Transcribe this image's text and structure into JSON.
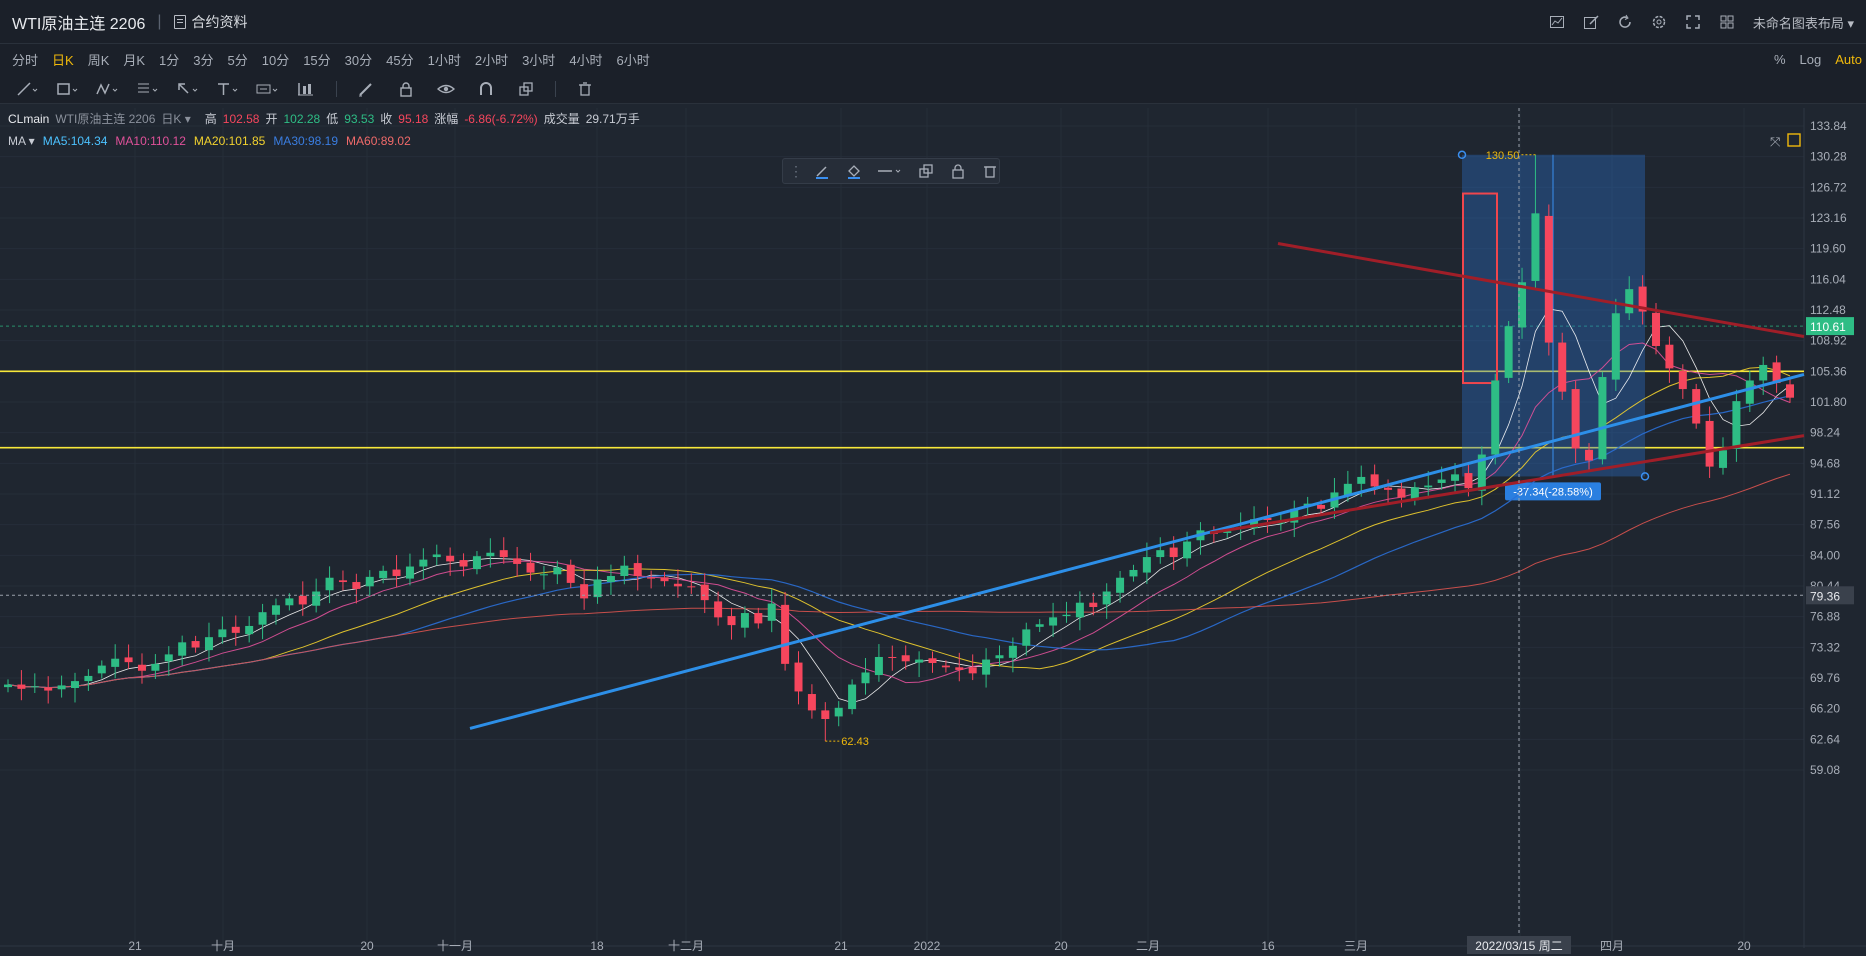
{
  "header": {
    "title": "WTI原油主连 2206",
    "contract_info": "合约资料",
    "layout_name": "未命名图表布局"
  },
  "intervals": [
    "分时",
    "日K",
    "周K",
    "月K",
    "1分",
    "3分",
    "5分",
    "10分",
    "15分",
    "30分",
    "45分",
    "1小时",
    "2小时",
    "3小时",
    "4小时",
    "6小时"
  ],
  "active_interval": "日K",
  "scale_options": {
    "percent": "%",
    "log": "Log",
    "auto": "Auto"
  },
  "legend": {
    "symbol": "CLmain",
    "name": "WTI原油主连 2206",
    "period": "日K",
    "high_label": "高",
    "high": "102.58",
    "open_label": "开",
    "open": "102.28",
    "low_label": "低",
    "low": "93.53",
    "close_label": "收",
    "close": "95.18",
    "change_label": "涨幅",
    "change": "-6.86(-6.72%)",
    "volume_label": "成交量",
    "volume": "29.71万手"
  },
  "ma_legend": {
    "label": "MA",
    "ma5": "MA5:104.34",
    "ma10": "MA10:110.12",
    "ma20": "MA20:101.85",
    "ma30": "MA30:98.19",
    "ma60": "MA60:89.02"
  },
  "colors": {
    "up": "#2ebd85",
    "down": "#f6465d",
    "ma5": "#ffffff",
    "ma10": "#e0519a",
    "ma20": "#f2d22e",
    "ma30": "#2a6fd6",
    "ma60": "#d9534f",
    "accent": "#f0b90b"
  },
  "price_axis": [
    "133.84",
    "130.28",
    "126.72",
    "123.16",
    "119.60",
    "116.04",
    "112.48",
    "108.92",
    "105.36",
    "101.80",
    "98.24",
    "94.68",
    "91.12",
    "87.56",
    "84.00",
    "80.44",
    "76.88",
    "73.32",
    "69.76",
    "66.20",
    "62.64",
    "59.08"
  ],
  "price_tags": {
    "last": "110.61",
    "crosshair": "79.36"
  },
  "time_axis": [
    "21",
    "十月",
    "20",
    "十一月",
    "18",
    "十二月",
    "21",
    "2022",
    "20",
    "二月",
    "16",
    "三月",
    "22",
    "四月",
    "20"
  ],
  "crosshair_date": "2022/03/15 周二",
  "annotations": {
    "high_label": "130.50",
    "low_label": "62.43",
    "measure_label": "-37.34(-28.58%)"
  },
  "chart_data": {
    "type": "candlestick",
    "instrument": "WTI原油主连 2206",
    "y_range": [
      57.3,
      135.6
    ],
    "y_ticks": [
      133.84,
      130.28,
      126.72,
      123.16,
      119.6,
      116.04,
      112.48,
      108.92,
      105.36,
      101.8,
      98.24,
      94.68,
      91.12,
      87.56,
      84.0,
      80.44,
      76.88,
      73.32,
      69.76,
      66.2,
      62.64,
      59.08
    ],
    "x_labels": [
      "21",
      "十月",
      "20",
      "十一月",
      "18",
      "十二月",
      "21",
      "2022",
      "20",
      "二月",
      "16",
      "三月",
      "22",
      "四月",
      "20"
    ],
    "closes": [
      69.0,
      68.5,
      68.8,
      68.3,
      68.9,
      69.4,
      70.0,
      71.2,
      72.0,
      71.6,
      70.6,
      71.4,
      72.5,
      73.9,
      73.3,
      74.5,
      75.4,
      75.0,
      75.8,
      77.4,
      78.2,
      79.0,
      78.3,
      79.8,
      81.4,
      80.9,
      80.1,
      81.5,
      82.2,
      81.6,
      82.7,
      83.5,
      84.1,
      83.3,
      82.7,
      83.9,
      84.3,
      83.8,
      83.0,
      82.0,
      81.8,
      82.6,
      80.8,
      79.0,
      81.2,
      81.6,
      82.8,
      81.6,
      81.3,
      81.0,
      80.4,
      80.3,
      78.8,
      76.8,
      75.9,
      77.3,
      76.1,
      78.4,
      71.4,
      68.2,
      66.0,
      65.0,
      66.3,
      69.0,
      70.4,
      72.2,
      72.1,
      71.7,
      71.9,
      71.5,
      71.0,
      70.7,
      70.3,
      71.9,
      72.4,
      73.5,
      75.4,
      76.0,
      76.8,
      77.1,
      78.5,
      78.0,
      79.8,
      81.4,
      82.3,
      83.8,
      84.6,
      83.8,
      85.6,
      86.9,
      86.6,
      86.8,
      87.3,
      88.2,
      88.1,
      87.8,
      89.4,
      90.0,
      89.4,
      91.3,
      92.3,
      93.1,
      92.0,
      91.6,
      90.7,
      91.9,
      92.1,
      92.8,
      93.4,
      91.8,
      95.7,
      104.3,
      110.6,
      115.7,
      123.7,
      108.7,
      103.0,
      96.4,
      95.0,
      104.7,
      112.1,
      114.9,
      112.3,
      108.3,
      105.7,
      103.3,
      99.3,
      94.3,
      96.2,
      101.9,
      104.3,
      106.1,
      104.0,
      102.3
    ],
    "ma_current": {
      "MA5": 104.34,
      "MA10": 110.12,
      "MA20": 101.85,
      "MA30": 98.19,
      "MA60": 89.02
    },
    "horizontal_lines": [
      105.36,
      96.5
    ],
    "high": 130.5,
    "low": 62.43,
    "measure": {
      "from": 130.5,
      "to": 93.16,
      "change": -37.34,
      "percent": -28.58
    }
  }
}
